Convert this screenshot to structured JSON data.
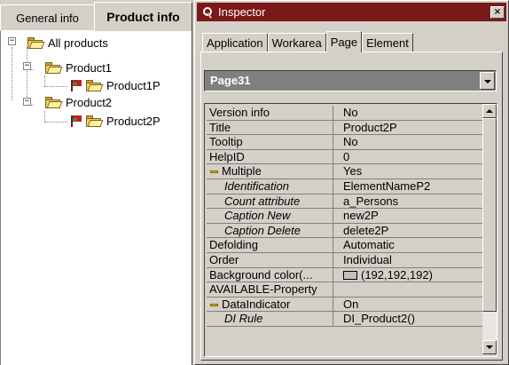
{
  "left_pane": {
    "tabs": [
      {
        "label": "General info",
        "active": false
      },
      {
        "label": "Product info",
        "active": true
      }
    ],
    "tree": [
      {
        "label": "All products",
        "expander": "−",
        "icon": "folder-icon"
      },
      {
        "label": "Product1",
        "expander": "−",
        "icon": "folder-icon"
      },
      {
        "label": "Product1P",
        "icon": "page-icon"
      },
      {
        "label": "Product2",
        "expander": "−",
        "icon": "folder-icon"
      },
      {
        "label": "Product2P",
        "icon": "page-icon"
      }
    ]
  },
  "inspector": {
    "title": "Inspector",
    "close_label": "×",
    "tabs": [
      {
        "label": "Application"
      },
      {
        "label": "Workarea"
      },
      {
        "label": "Page",
        "active": true
      },
      {
        "label": "Element"
      }
    ],
    "selector": {
      "value": "Page31"
    },
    "properties": [
      {
        "name": "Version info",
        "value": "No"
      },
      {
        "name": "Title",
        "value": "Product2P"
      },
      {
        "name": "Tooltip",
        "value": "No"
      },
      {
        "name": "HelpID",
        "value": "0"
      },
      {
        "name": "Multiple",
        "value": "Yes",
        "group": true
      },
      {
        "name": "Identification",
        "value": "ElementNameP2",
        "sub": true
      },
      {
        "name": "Count attribute",
        "value": "a_Persons",
        "sub": true
      },
      {
        "name": "Caption New",
        "value": "new2P",
        "sub": true
      },
      {
        "name": "Caption Delete",
        "value": "delete2P",
        "sub": true
      },
      {
        "name": "Defolding",
        "value": "Automatic"
      },
      {
        "name": "Order",
        "value": "Individual"
      },
      {
        "name": "Background color(...",
        "value": "(192,192,192)",
        "swatch": "#c0c0c0"
      },
      {
        "name": "AVAILABLE-Property",
        "value": ""
      },
      {
        "name": "DataIndicator",
        "value": "On",
        "group": true
      },
      {
        "name": "DI Rule",
        "value": "DI_Product2()",
        "sub": true
      }
    ]
  },
  "colors": {
    "titlebar": "#7b1818",
    "face": "#d4d0c8",
    "selector_bg": "#808080"
  }
}
